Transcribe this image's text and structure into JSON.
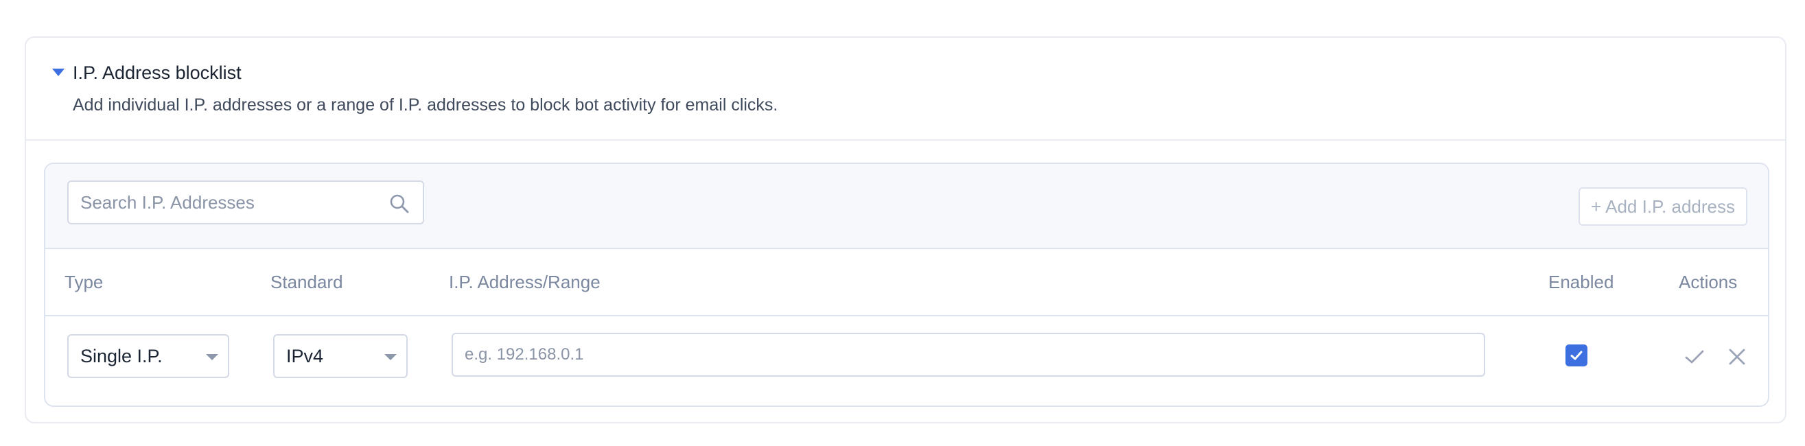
{
  "section": {
    "title": "I.P. Address blocklist",
    "description": "Add individual I.P. addresses or a range of I.P. addresses to block bot activity for email clicks."
  },
  "toolbar": {
    "search_placeholder": "Search I.P. Addresses",
    "add_button_label": "+ Add I.P. address"
  },
  "table": {
    "columns": {
      "type": "Type",
      "standard": "Standard",
      "address": "I.P. Address/Range",
      "enabled": "Enabled",
      "actions": "Actions"
    },
    "rows": [
      {
        "type": "Single I.P.",
        "standard": "IPv4",
        "address_value": "",
        "address_placeholder": "e.g. 192.168.0.1",
        "enabled": true
      }
    ]
  },
  "icons": {
    "caret": "caret-down-icon",
    "search": "search-icon",
    "type_dropdown": "chevron-down-icon",
    "standard_dropdown": "chevron-down-icon",
    "enabled_check": "check-icon",
    "confirm": "check-icon",
    "cancel": "close-icon"
  },
  "colors": {
    "accent": "#3d6fe0",
    "border": "#dde3ee",
    "toolbar_bg": "#f6f8fc",
    "muted_text": "#7b88a0"
  }
}
